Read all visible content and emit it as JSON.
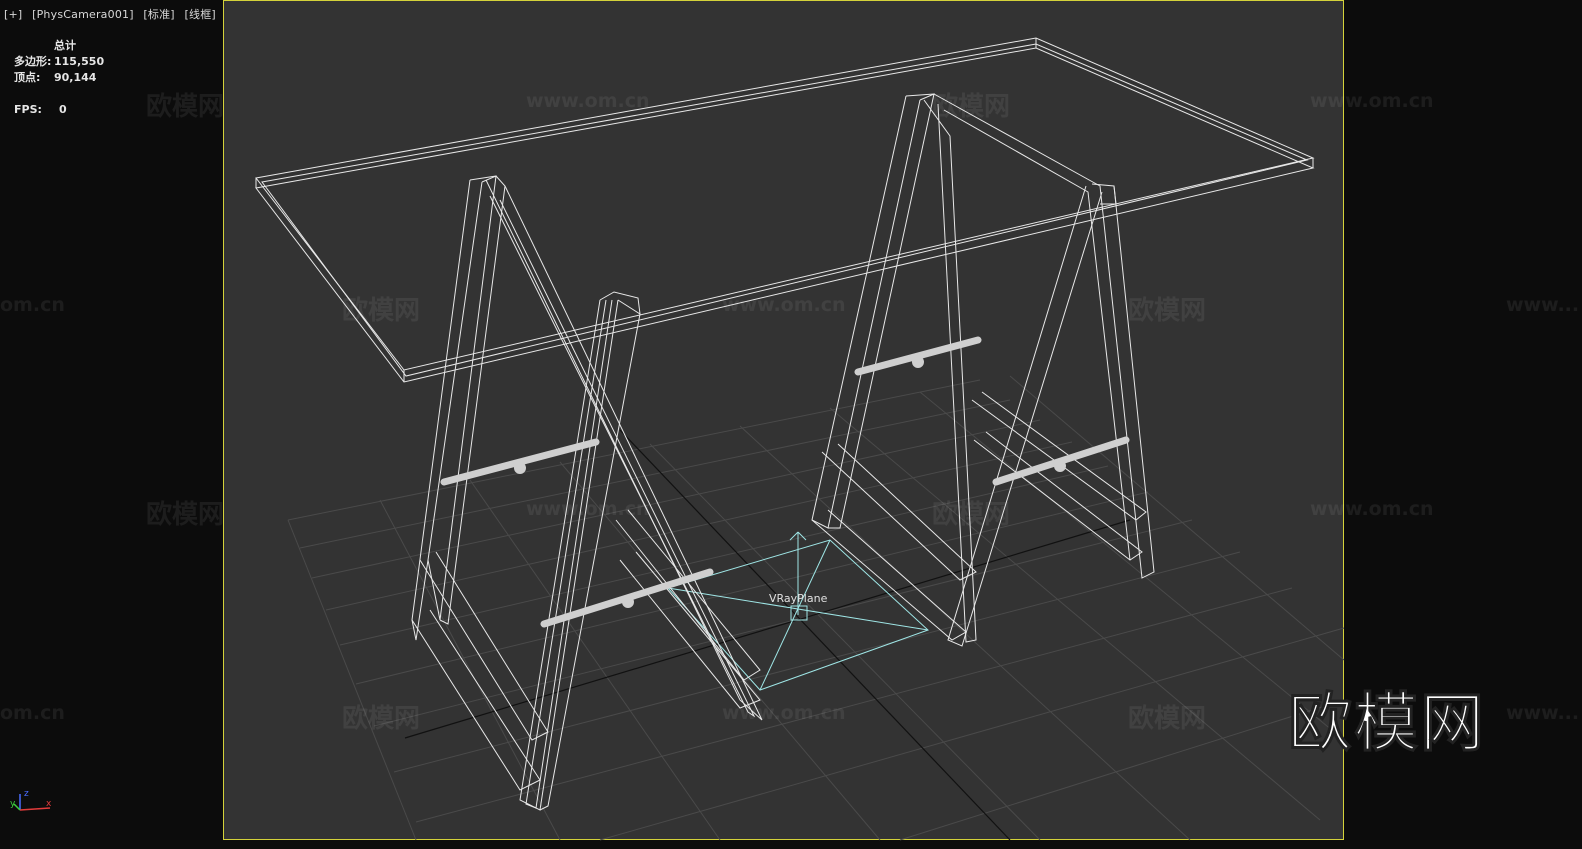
{
  "viewport": {
    "labels": [
      "[+]",
      "[PhysCamera001]",
      "[标准]",
      "[线框]"
    ]
  },
  "stats": {
    "header": "总计",
    "polygons_label": "多边形:",
    "polygons_value": "115,550",
    "vertices_label": "顶点:",
    "vertices_value": "90,144",
    "fps_label": "FPS:",
    "fps_value": "0"
  },
  "scene": {
    "object_label": "VRayPlane",
    "wireframe_color": "#e8e8e8",
    "grid_color": "#4a4a4a",
    "selection_color": "#9fe6e6",
    "frame_color": "#d4d23a"
  },
  "watermarks": {
    "cn": "欧模网",
    "url": "www.om.cn",
    "url_partial_left": "om.cn",
    "url_partial_right": "www..."
  },
  "brand_logo": "欧模网",
  "axis": {
    "x": "x",
    "y": "y",
    "z": "z"
  }
}
